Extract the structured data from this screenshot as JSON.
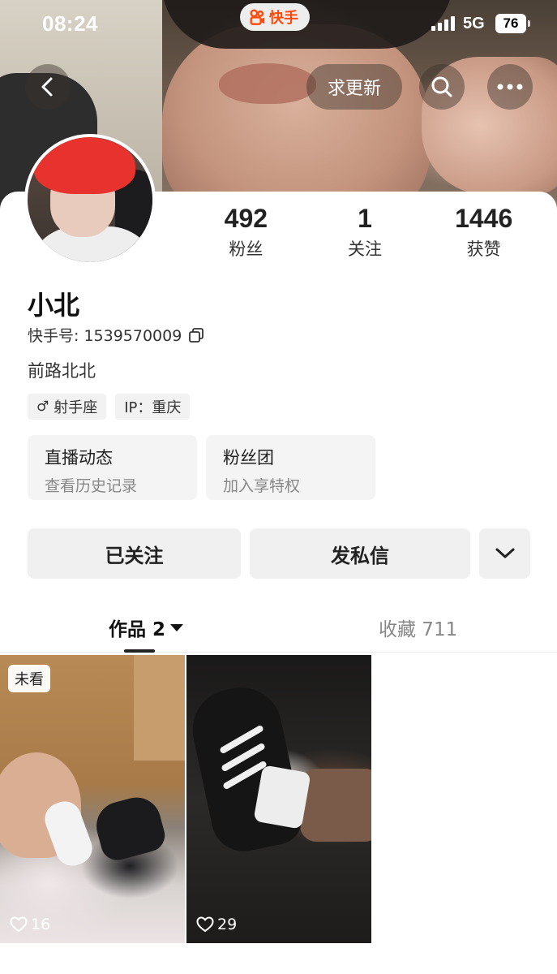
{
  "status_bar": {
    "time": "08:24",
    "app_brand": "快手",
    "network": "5G",
    "battery": "76"
  },
  "header": {
    "update_button": "求更新",
    "icons": [
      "back-icon",
      "search-icon",
      "more-icon"
    ]
  },
  "profile": {
    "name": "小北",
    "kuaishou_id": "快手号: 1539570009",
    "bio": "前路北北",
    "stats": [
      {
        "value": "492",
        "label": "粉丝"
      },
      {
        "value": "1",
        "label": "关注"
      },
      {
        "value": "1446",
        "label": "获赞"
      }
    ],
    "tags": {
      "gender_symbol": "♂",
      "zodiac": "射手座",
      "ip": "IP：重庆"
    },
    "entries": [
      {
        "title": "直播动态",
        "subtitle": "查看历史记录"
      },
      {
        "title": "粉丝团",
        "subtitle": "加入享特权"
      }
    ],
    "actions": {
      "follow": "已关注",
      "message": "发私信"
    }
  },
  "tabs": {
    "works": "作品 2",
    "favorites": "收藏 711"
  },
  "works": [
    {
      "badge": "未看",
      "likes": "16"
    },
    {
      "badge": "",
      "likes": "29"
    }
  ],
  "colors": {
    "brand": "#ff4906",
    "button_bg": "#f0f0f0",
    "entry_bg": "#f4f4f4",
    "muted_text": "#888888"
  }
}
